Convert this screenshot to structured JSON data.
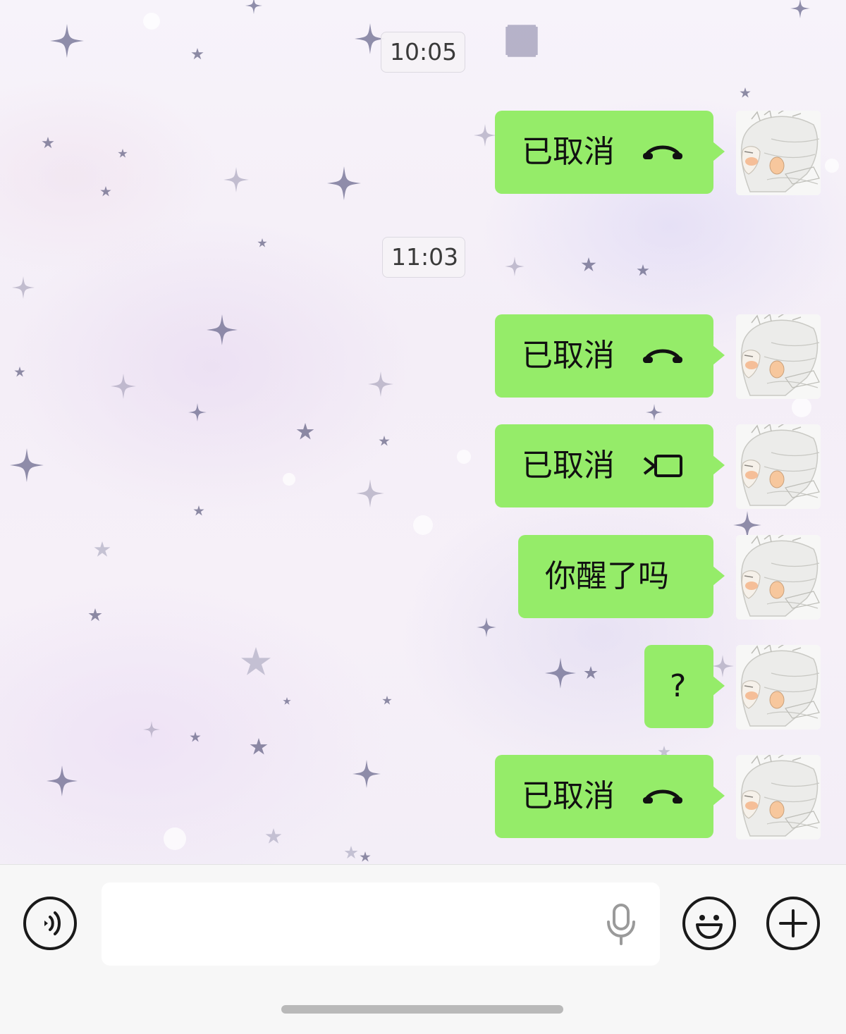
{
  "colors": {
    "bubble_green": "#95ec69",
    "bubble_text": "#111111",
    "timestamp_text": "#3a3a3a",
    "input_bar_bg": "#f7f7f7",
    "icon_dark": "#1a1a1a"
  },
  "chat": {
    "timestamps": [
      "10:05",
      "11:03"
    ],
    "messages": [
      {
        "text": "已取消",
        "icon": "voice-call-cancelled-icon"
      },
      {
        "text": "已取消",
        "icon": "voice-call-cancelled-icon"
      },
      {
        "text": "已取消",
        "icon": "video-call-cancelled-icon"
      },
      {
        "text": "你醒了吗",
        "icon": ""
      },
      {
        "text": "?",
        "icon": ""
      },
      {
        "text": "已取消",
        "icon": "voice-call-cancelled-icon"
      }
    ],
    "avatar_icon": "user-avatar-illustration"
  },
  "input_bar": {
    "voice_toggle_icon": "voice-mode-icon",
    "text_value": "",
    "mic_icon": "microphone-icon",
    "emoji_icon": "emoji-smile-icon",
    "more_icon": "plus-icon"
  }
}
